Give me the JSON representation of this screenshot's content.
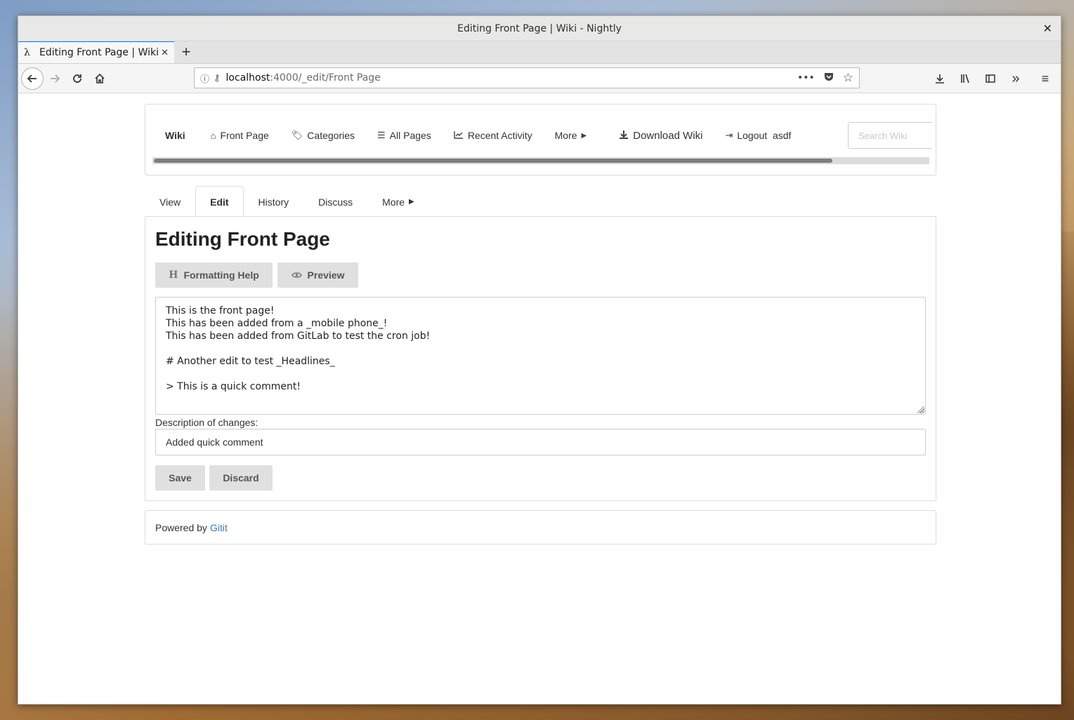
{
  "window": {
    "title": "Editing Front Page | Wiki - Nightly",
    "close_glyph": "✕"
  },
  "browser": {
    "tab_title": "Editing Front Page | Wiki",
    "tab_favicon": "λ",
    "url_host": "localhost",
    "url_rest": ":4000/_edit/Front Page"
  },
  "wiki_nav": {
    "brand": "Wiki",
    "items": [
      {
        "label": "Front Page",
        "icon": "home-icon"
      },
      {
        "label": "Categories",
        "icon": "tags-icon"
      },
      {
        "label": "All Pages",
        "icon": "list-icon"
      },
      {
        "label": "Recent Activity",
        "icon": "chart-icon"
      },
      {
        "label": "More",
        "icon": "caret-right-icon"
      },
      {
        "label": "Download Wiki",
        "icon": "download-icon"
      },
      {
        "label": "Logout  asdf",
        "icon": "logout-icon"
      }
    ],
    "search_placeholder": "Search Wiki"
  },
  "page_tabs": [
    "View",
    "Edit",
    "History",
    "Discuss",
    "More"
  ],
  "editor": {
    "heading": "Editing Front Page",
    "formatting_help_label": "Formatting Help",
    "preview_label": "Preview",
    "content": "This is the front page!\nThis has been added from a _mobile phone_!\nThis has been added from GitLab to test the cron job!\n\n# Another edit to test _Headlines_\n\n> This is a quick comment!",
    "description_label": "Description of changes:",
    "description_value": "Added quick comment",
    "save_label": "Save",
    "discard_label": "Discard"
  },
  "footer": {
    "prefix": "Powered by",
    "link_label": "Gitit"
  }
}
